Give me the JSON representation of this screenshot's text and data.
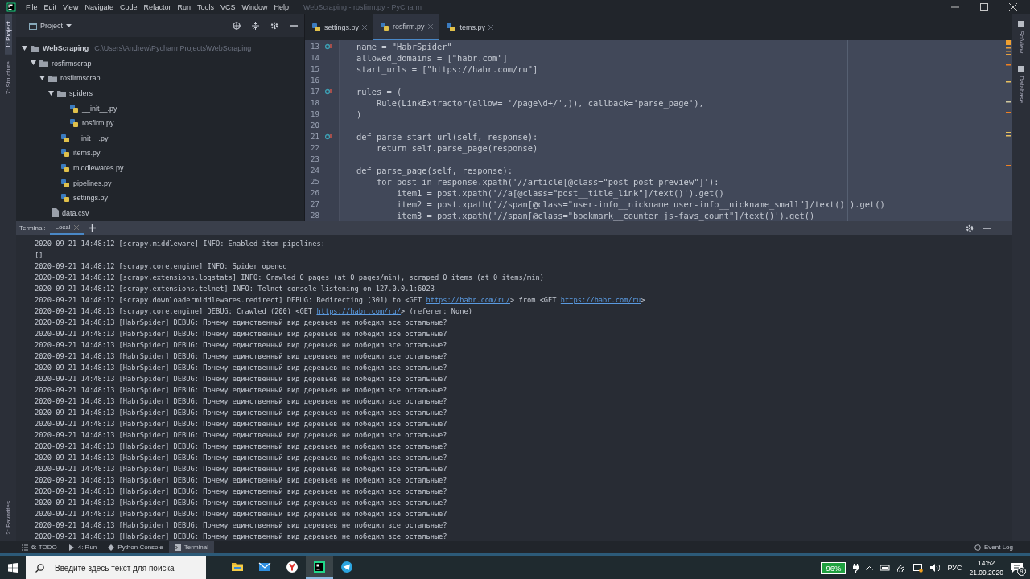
{
  "window": {
    "title": "WebScraping - rosfirm.py - PyCharm"
  },
  "menu": [
    "File",
    "Edit",
    "View",
    "Navigate",
    "Code",
    "Refactor",
    "Run",
    "Tools",
    "VCS",
    "Window",
    "Help"
  ],
  "left_strip": [
    {
      "label": "1: Project",
      "selected": true
    },
    {
      "label": "7: Structure",
      "selected": false
    },
    {
      "label": "2: Favorites",
      "selected": false
    }
  ],
  "right_strip": [
    {
      "label": "SciView"
    },
    {
      "label": "Database"
    }
  ],
  "project": {
    "title": "Project",
    "tree": [
      {
        "name": "WebScraping",
        "kind": "folder",
        "path": "C:\\Users\\Andrew\\PycharmProjects\\WebScraping",
        "expanded": true,
        "children": [
          {
            "name": "rosfirmscrap",
            "kind": "folder",
            "expanded": true,
            "children": [
              {
                "name": "rosfirmscrap",
                "kind": "folder",
                "expanded": true,
                "children": [
                  {
                    "name": "spiders",
                    "kind": "folder",
                    "expanded": true,
                    "children": [
                      {
                        "name": "__init__.py",
                        "kind": "python"
                      },
                      {
                        "name": "rosfirm.py",
                        "kind": "python"
                      }
                    ]
                  },
                  {
                    "name": "__init__.py",
                    "kind": "python"
                  },
                  {
                    "name": "items.py",
                    "kind": "python"
                  },
                  {
                    "name": "middlewares.py",
                    "kind": "python"
                  },
                  {
                    "name": "pipelines.py",
                    "kind": "python"
                  },
                  {
                    "name": "settings.py",
                    "kind": "python"
                  }
                ]
              },
              {
                "name": "data.csv",
                "kind": "file"
              }
            ]
          }
        ]
      }
    ]
  },
  "editor": {
    "tabs": [
      {
        "label": "settings.py",
        "selected": false
      },
      {
        "label": "rosfirm.py",
        "selected": true
      },
      {
        "label": "items.py",
        "selected": false
      }
    ],
    "lines": [
      {
        "number": "13",
        "text": "name = \"HabrSpider\"",
        "override": true
      },
      {
        "number": "14",
        "text": "allowed_domains = [\"habr.com\"]",
        "override": false
      },
      {
        "number": "15",
        "text": "start_urls = [\"https://habr.com/ru\"]",
        "override": false
      },
      {
        "number": "16",
        "override": false
      },
      {
        "number": "17",
        "text": "rules = (",
        "override": true
      },
      {
        "number": "18",
        "text": "    Rule(LinkExtractor(allow= '/page\\d+/',)), callback='parse_page'),",
        "override": false
      },
      {
        "number": "19",
        "text": ")",
        "override": false
      },
      {
        "number": "20",
        "override": false
      },
      {
        "number": "21",
        "text": "def parse_start_url(self, response):",
        "override": true
      },
      {
        "number": "22",
        "text": "    return self.parse_page(response)",
        "override": false
      },
      {
        "number": "23",
        "override": false
      },
      {
        "number": "24",
        "text": "def parse_page(self, response):",
        "override": false
      },
      {
        "number": "25",
        "text": "    for post in response.xpath('//article[@class=\"post post_preview\"]'):",
        "override": false
      },
      {
        "number": "26",
        "text": "        item1 = post.xpath('//a[@class=\"post__title_link\"]/text()').get()",
        "override": false
      },
      {
        "number": "27",
        "text": "        item2 = post.xpath('//span[@class=\"user-info__nickname user-info__nickname_small\"]/text()').get()",
        "override": false
      },
      {
        "number": "28",
        "text": "        item3 = post.xpath('//span[@class=\"bookmark__counter js-favs_count\"]/text()').get()",
        "override": false
      }
    ]
  },
  "terminal": {
    "title": "Terminal:",
    "tabs": [
      {
        "label": "Local",
        "selected": true
      }
    ],
    "lines": [
      {
        "parts": [
          {
            "text": "2020-09-21 14:48:12 [scrapy.middleware] INFO: Enabled item pipelines:"
          }
        ]
      },
      {
        "parts": [
          {
            "text": "[]"
          }
        ]
      },
      {
        "parts": [
          {
            "text": "2020-09-21 14:48:12 [scrapy.core.engine] INFO: Spider opened"
          }
        ]
      },
      {
        "parts": [
          {
            "text": "2020-09-21 14:48:12 [scrapy.extensions.logstats] INFO: Crawled 0 pages (at 0 pages/min), scraped 0 items (at 0 items/min)"
          }
        ]
      },
      {
        "parts": [
          {
            "text": "2020-09-21 14:48:12 [scrapy.extensions.telnet] INFO: Telnet console listening on 127.0.0.1:6023"
          }
        ]
      },
      {
        "parts": [
          {
            "text": "2020-09-21 14:48:12 [scrapy.downloadermiddlewares.redirect] DEBUG: Redirecting (301) to <GET "
          },
          {
            "text": "https://habr.com/ru/",
            "link": true
          },
          {
            "text": "> from <GET "
          },
          {
            "text": "https://habr.com/ru",
            "link": true
          },
          {
            "text": ">"
          }
        ]
      },
      {
        "parts": [
          {
            "text": "2020-09-21 14:48:13 [scrapy.core.engine] DEBUG: Crawled (200) <GET "
          },
          {
            "text": "https://habr.com/ru/",
            "link": true
          },
          {
            "text": "> (referer: None)"
          }
        ]
      },
      {
        "parts": [
          {
            "text": "2020-09-21 14:48:13 [HabrSpider] DEBUG: Почему единственный вид деревьев не победил все остальные?"
          }
        ]
      },
      {
        "parts": [
          {
            "text": "2020-09-21 14:48:13 [HabrSpider] DEBUG: Почему единственный вид деревьев не победил все остальные?"
          }
        ]
      },
      {
        "parts": [
          {
            "text": "2020-09-21 14:48:13 [HabrSpider] DEBUG: Почему единственный вид деревьев не победил все остальные?"
          }
        ]
      },
      {
        "parts": [
          {
            "text": "2020-09-21 14:48:13 [HabrSpider] DEBUG: Почему единственный вид деревьев не победил все остальные?"
          }
        ]
      },
      {
        "parts": [
          {
            "text": "2020-09-21 14:48:13 [HabrSpider] DEBUG: Почему единственный вид деревьев не победил все остальные?"
          }
        ]
      },
      {
        "parts": [
          {
            "text": "2020-09-21 14:48:13 [HabrSpider] DEBUG: Почему единственный вид деревьев не победил все остальные?"
          }
        ]
      },
      {
        "parts": [
          {
            "text": "2020-09-21 14:48:13 [HabrSpider] DEBUG: Почему единственный вид деревьев не победил все остальные?"
          }
        ]
      },
      {
        "parts": [
          {
            "text": "2020-09-21 14:48:13 [HabrSpider] DEBUG: Почему единственный вид деревьев не победил все остальные?"
          }
        ]
      },
      {
        "parts": [
          {
            "text": "2020-09-21 14:48:13 [HabrSpider] DEBUG: Почему единственный вид деревьев не победил все остальные?"
          }
        ]
      },
      {
        "parts": [
          {
            "text": "2020-09-21 14:48:13 [HabrSpider] DEBUG: Почему единственный вид деревьев не победил все остальные?"
          }
        ]
      },
      {
        "parts": [
          {
            "text": "2020-09-21 14:48:13 [HabrSpider] DEBUG: Почему единственный вид деревьев не победил все остальные?"
          }
        ]
      },
      {
        "parts": [
          {
            "text": "2020-09-21 14:48:13 [HabrSpider] DEBUG: Почему единственный вид деревьев не победил все остальные?"
          }
        ]
      },
      {
        "parts": [
          {
            "text": "2020-09-21 14:48:13 [HabrSpider] DEBUG: Почему единственный вид деревьев не победил все остальные?"
          }
        ]
      },
      {
        "parts": [
          {
            "text": "2020-09-21 14:48:13 [HabrSpider] DEBUG: Почему единственный вид деревьев не победил все остальные?"
          }
        ]
      },
      {
        "parts": [
          {
            "text": "2020-09-21 14:48:13 [HabrSpider] DEBUG: Почему единственный вид деревьев не победил все остальные?"
          }
        ]
      },
      {
        "parts": [
          {
            "text": "2020-09-21 14:48:13 [HabrSpider] DEBUG: Почему единственный вид деревьев не победил все остальные?"
          }
        ]
      },
      {
        "parts": [
          {
            "text": "2020-09-21 14:48:13 [HabrSpider] DEBUG: Почему единственный вид деревьев не победил все остальные?"
          }
        ]
      },
      {
        "parts": [
          {
            "text": "2020-09-21 14:48:13 [HabrSpider] DEBUG: Почему единственный вид деревьев не победил все остальные?"
          }
        ]
      },
      {
        "parts": [
          {
            "text": "2020-09-21 14:48:13 [HabrSpider] DEBUG: Почему единственный вид деревьев не победил все остальные?"
          }
        ]
      },
      {
        "parts": [
          {
            "text": "2020-09-21 14:48:13 [HabrSpider] DEBUG: Почему единственный вид деревьев не победил все остальные?"
          }
        ]
      }
    ]
  },
  "bottom_tabs": [
    {
      "label": "6: TODO",
      "kind": "todo",
      "selected": false
    },
    {
      "label": "4: Run",
      "kind": "run",
      "selected": false
    },
    {
      "label": "Python Console",
      "kind": "console",
      "selected": false
    },
    {
      "label": "Terminal",
      "kind": "terminal",
      "selected": true
    }
  ],
  "event_log": "Event Log",
  "taskbar": {
    "search_placeholder": "Введите здесь текст для поиска",
    "apps": [
      {
        "kind": "explorer",
        "active": false
      },
      {
        "kind": "mail",
        "active": false
      },
      {
        "kind": "browser",
        "active": false
      },
      {
        "kind": "pycharm",
        "active": true
      },
      {
        "kind": "telegram",
        "active": false
      }
    ],
    "battery": "96%",
    "language": "РУС",
    "time": "14:52",
    "date": "21.09.2020",
    "notifications": "9"
  }
}
